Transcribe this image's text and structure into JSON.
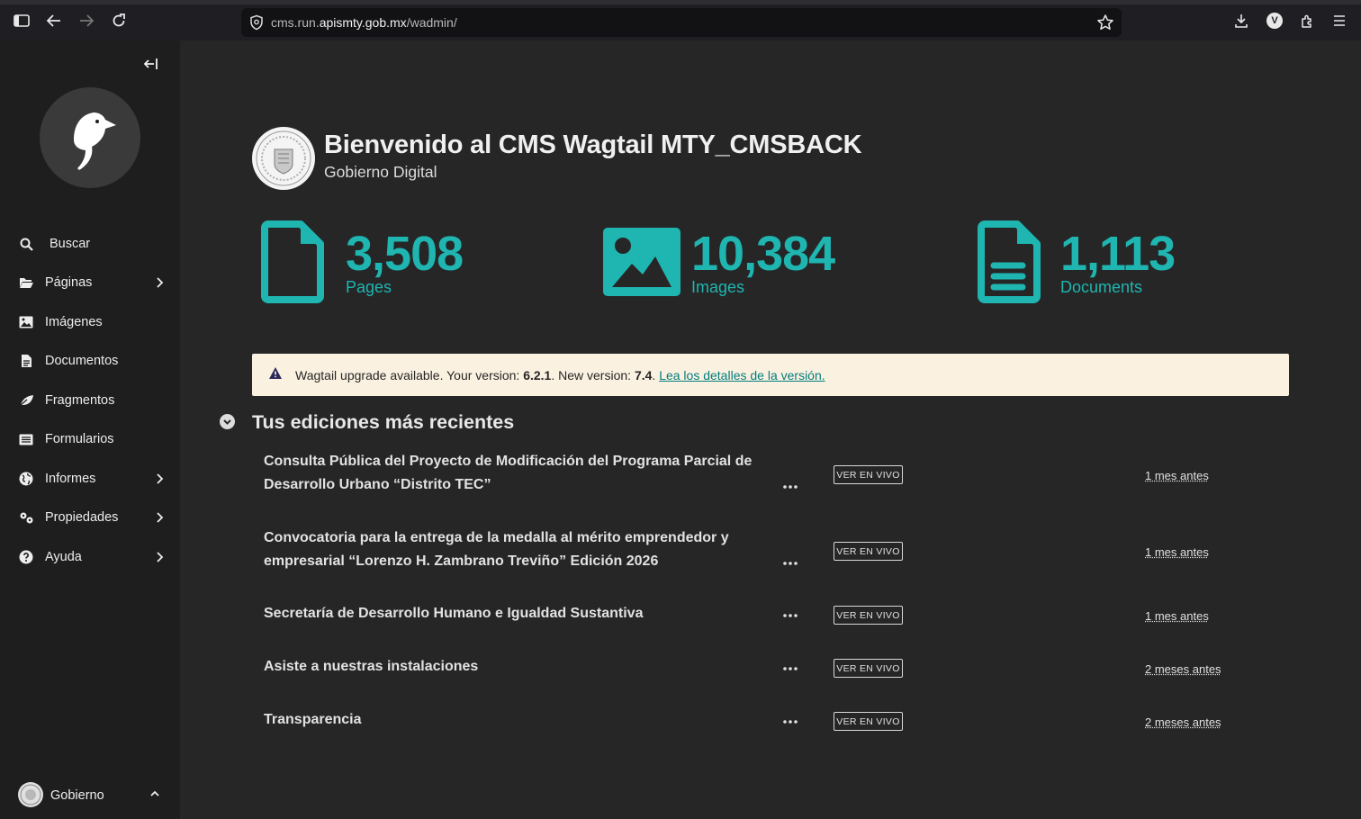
{
  "browser": {
    "url_prefix": "cms.run.",
    "url_domain": "apismty.gob.mx",
    "url_path": "/wadmin/",
    "profile_initial": "V"
  },
  "sidebar": {
    "items": [
      {
        "label": "Buscar",
        "icon": "search-icon"
      },
      {
        "label": "Páginas",
        "icon": "folder-open-icon",
        "has_submenu": true
      },
      {
        "label": "Imágenes",
        "icon": "image-icon"
      },
      {
        "label": "Documentos",
        "icon": "document-icon"
      },
      {
        "label": "Fragmentos",
        "icon": "snippet-icon"
      },
      {
        "label": "Formularios",
        "icon": "list-icon"
      },
      {
        "label": "Informes",
        "icon": "globe-icon",
        "has_submenu": true
      },
      {
        "label": "Propiedades",
        "icon": "cogs-icon",
        "has_submenu": true
      },
      {
        "label": "Ayuda",
        "icon": "help-icon",
        "has_submenu": true
      }
    ],
    "user": {
      "name": "Gobierno"
    }
  },
  "header": {
    "title": "Bienvenido al CMS Wagtail MTY_CMSBACK",
    "subtitle": "Gobierno Digital"
  },
  "stats": {
    "pages": {
      "count": "3,508",
      "label": "Pages"
    },
    "images": {
      "count": "10,384",
      "label": "Images"
    },
    "documents": {
      "count": "1,113",
      "label": "Documents"
    }
  },
  "notice": {
    "text_1": "Wagtail upgrade available. Your version: ",
    "current_version": "6.2.1",
    "text_2": ". New version: ",
    "new_version": "7.4",
    "text_3": ". ",
    "link": "Lea los detalles de la versión."
  },
  "recent": {
    "heading": "Tus ediciones más recientes",
    "live_label": "VER EN VIVO",
    "rows": [
      {
        "title": "Consulta Pública del Proyecto de Modificación del Programa Parcial de Desarrollo Urbano “Distrito TEC”",
        "when": "1 mes antes"
      },
      {
        "title": "Convocatoria para la entrega de la medalla al mérito emprendedor y empresarial “Lorenzo H. Zambrano Treviño” Edición 2026",
        "when": "1 mes antes"
      },
      {
        "title": "Secretaría de Desarrollo Humano e Igualdad Sustantiva",
        "when": "1 mes antes"
      },
      {
        "title": "Asiste a nuestras instalaciones",
        "when": "2 meses antes"
      },
      {
        "title": "Transparencia",
        "when": "2 meses antes"
      }
    ]
  },
  "colors": {
    "accent": "#1fb5b1",
    "notice_bg": "#fbf1e0",
    "sidebar_bg": "#1e1e1e",
    "main_bg": "#262626"
  }
}
